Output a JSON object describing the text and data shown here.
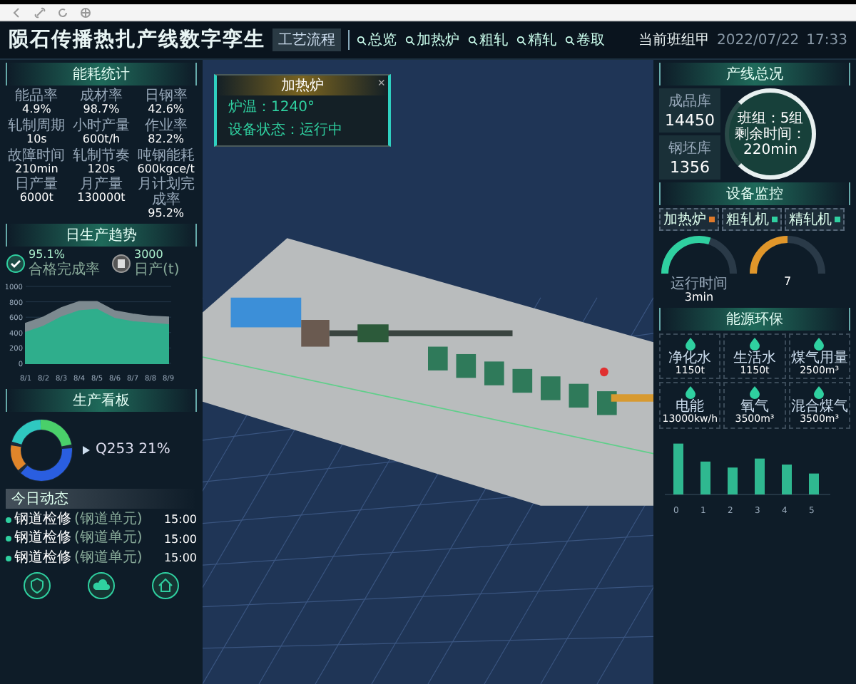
{
  "header": {
    "title": "陨石传播热扎产线数字孪生",
    "process_button": "工艺流程",
    "nav": [
      "总览",
      "加热炉",
      "粗轧",
      "精轧",
      "卷取"
    ],
    "shift": "当前班组甲",
    "date": "2022/07/22",
    "time": "17:33"
  },
  "stats_panel": {
    "title": "能耗统计",
    "items": [
      {
        "label": "能品率",
        "value": "4.9%"
      },
      {
        "label": "成材率",
        "value": "98.7%"
      },
      {
        "label": "日钢率",
        "value": "42.6%"
      },
      {
        "label": "轧制周期",
        "value": "10s"
      },
      {
        "label": "小时产量",
        "value": "600t/h"
      },
      {
        "label": "作业率",
        "value": "82.2%"
      },
      {
        "label": "故障时间",
        "value": "210min"
      },
      {
        "label": "轧制节奏",
        "value": "120s"
      },
      {
        "label": "吨钢能耗",
        "value": "600kgce/t"
      },
      {
        "label": "日产量",
        "value": "6000t"
      },
      {
        "label": "月产量",
        "value": "130000t"
      },
      {
        "label": "月计划完成率",
        "value": "95.2%"
      }
    ]
  },
  "popup": {
    "title": "加热炉",
    "close": "×",
    "lines": [
      "炉温：1240°",
      "设备状态：运行中"
    ]
  },
  "trend_panel": {
    "title": "日生产趋势",
    "kpis": [
      {
        "value": "95.1%",
        "label": "合格完成率"
      },
      {
        "value": "3000",
        "label": "日产(t)"
      }
    ],
    "chart_data": {
      "type": "area",
      "grid": true,
      "x": [
        "8/1",
        "8/2",
        "8/3",
        "8/4",
        "8/5",
        "8/6",
        "8/7",
        "8/8",
        "8/9"
      ],
      "ylim": [
        0,
        1000
      ],
      "yticks": [
        0,
        200,
        400,
        600,
        800,
        1000
      ],
      "series": [
        {
          "color": "#7d8a90",
          "values": [
            520,
            600,
            720,
            800,
            800,
            680,
            640,
            610,
            600
          ]
        },
        {
          "color": "#2fae8c",
          "values": [
            400,
            480,
            600,
            680,
            700,
            580,
            540,
            520,
            500
          ]
        }
      ]
    }
  },
  "board_panel": {
    "title": "生产看板",
    "legend": "Q253 21%"
  },
  "today": {
    "title": "今日动态",
    "items": [
      {
        "name": "钢道检修",
        "unit": "(钢道单元)",
        "time": "15:00"
      },
      {
        "name": "钢道检修",
        "unit": "(钢道单元)",
        "time": "15:00"
      },
      {
        "name": "钢道检修",
        "unit": "(钢道单元)",
        "time": "15:00"
      }
    ]
  },
  "line_panel": {
    "title": "产线总况",
    "stores": [
      {
        "label": "成品库",
        "value": "14450"
      },
      {
        "label": "钢坯库",
        "value": "1356"
      }
    ],
    "gauge_lines": [
      "班组：5组",
      "剩余时间：220min"
    ]
  },
  "equipment_panel": {
    "title": "设备监控",
    "tabs": [
      {
        "label": "加热炉",
        "color": "#e07a2a"
      },
      {
        "label": "粗轧机",
        "color": "#2fd0a0"
      },
      {
        "label": "精轧机",
        "color": "#2fd0a0"
      }
    ],
    "gauges": [
      {
        "label": "运行时间",
        "value": "3min",
        "level": 0.6,
        "color": "#2fd0a0"
      },
      {
        "value": "7",
        "level": 0.5,
        "color": "#e0962a"
      }
    ]
  },
  "energy_panel": {
    "title": "能源环保",
    "items": [
      {
        "label": "净化水",
        "value": "1150t"
      },
      {
        "label": "生活水",
        "value": "1150t"
      },
      {
        "label": "煤气用量",
        "value": "2500m³"
      },
      {
        "label": "电能",
        "value": "13000kw/h"
      },
      {
        "label": "氧气",
        "value": "3500m³"
      },
      {
        "label": "混合煤气",
        "value": "3500m³"
      }
    ],
    "bar_labels": [
      "0",
      "1",
      "2",
      "3",
      "4",
      "5"
    ]
  }
}
